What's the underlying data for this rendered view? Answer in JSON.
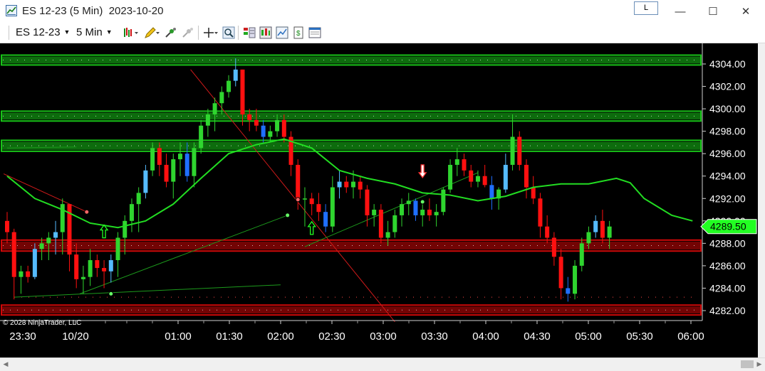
{
  "window": {
    "title": "ES 12-23 (5 Min)  2023-10-20",
    "link_button": "L",
    "minimize": "—",
    "maximize": "☐",
    "close": "✕"
  },
  "toolbar": {
    "instrument": "ES 12-23",
    "interval": "5 Min",
    "icons": [
      "bar-type-icon",
      "drawing-pencil-icon",
      "indicators-icon",
      "strategies-icon",
      "crosshair-icon",
      "zoom-icon",
      "chart-trader-icon",
      "data-box-icon",
      "properties-icon",
      "snapshot-icon",
      "share-icon"
    ]
  },
  "copyright": "© 2023 NinjaTrader, LLC",
  "colors": {
    "background": "#000000",
    "up_candle": "#2fd52f",
    "down_candle": "#ff1010",
    "tick_up": "#1f6fff",
    "tick_down": "#55bbff",
    "moving_average": "#22dd22",
    "green_zone": "#18c418",
    "red_zone": "#d10808",
    "price_marker": "#22ff22"
  },
  "chart_data": {
    "type": "candlestick",
    "instrument": "ES 12-23",
    "interval": "5 Min",
    "y_ticks": [
      4282.0,
      4284.0,
      4286.0,
      4288.0,
      4290.0,
      4292.0,
      4294.0,
      4296.0,
      4298.0,
      4300.0,
      4302.0,
      4304.0
    ],
    "ylim": [
      4280.0,
      4305.5
    ],
    "x_ticks": [
      "23:30",
      "10/20",
      "01:00",
      "01:30",
      "02:00",
      "02:30",
      "03:00",
      "03:30",
      "04:00",
      "04:30",
      "05:00",
      "05:30",
      "06:00"
    ],
    "last_price": "4289.50",
    "zones": [
      {
        "color": "green",
        "price_low": 4304.1,
        "price_high": 4304.6
      },
      {
        "color": "green",
        "price_low": 4299.1,
        "price_high": 4299.6
      },
      {
        "color": "green",
        "price_low": 4296.4,
        "price_high": 4297.0
      },
      {
        "color": "red",
        "price_low": 4287.5,
        "price_high": 4288.1
      },
      {
        "color": "red",
        "price_low": 4281.8,
        "price_high": 4282.3
      }
    ],
    "candles": [
      [
        4290,
        4290.8,
        4288,
        4289
      ],
      [
        4289,
        4289.3,
        4283,
        4285
      ],
      [
        4285,
        4286,
        4283.5,
        4285.5
      ],
      [
        4285.5,
        4286,
        4284.5,
        4285
      ],
      [
        4285,
        4288,
        4284.8,
        4287.5
      ],
      [
        4287.5,
        4288.5,
        4286.5,
        4288
      ],
      [
        4288,
        4289,
        4286.5,
        4288.5
      ],
      [
        4288.5,
        4290,
        4287,
        4289
      ],
      [
        4289,
        4292,
        4287,
        4291.5
      ],
      [
        4291.5,
        4291.5,
        4285.5,
        4287
      ],
      [
        4287,
        4288,
        4284,
        4284.8
      ],
      [
        4284.8,
        4286,
        4283.5,
        4285
      ],
      [
        4285,
        4287.5,
        4284.2,
        4286.5
      ],
      [
        4286.5,
        4287,
        4285,
        4285.8
      ],
      [
        4285.8,
        4286.5,
        4284,
        4285.5
      ],
      [
        4285.5,
        4287,
        4284.5,
        4286.5
      ],
      [
        4286.5,
        4289,
        4285,
        4288.5
      ],
      [
        4288.5,
        4290.5,
        4287,
        4290
      ],
      [
        4290,
        4292,
        4289,
        4291.5
      ],
      [
        4291.5,
        4293,
        4289,
        4292.5
      ],
      [
        4292.5,
        4295,
        4292,
        4294.5
      ],
      [
        4294.5,
        4297,
        4294,
        4296.5
      ],
      [
        4296.5,
        4297,
        4294,
        4295
      ],
      [
        4295,
        4296,
        4293,
        4293.5
      ],
      [
        4293.5,
        4296,
        4292,
        4295.5
      ],
      [
        4295.5,
        4297,
        4294,
        4296
      ],
      [
        4296,
        4297,
        4293.5,
        4294
      ],
      [
        4294,
        4297,
        4293,
        4296.5
      ],
      [
        4296.5,
        4299,
        4296,
        4298.5
      ],
      [
        4298.5,
        4300,
        4297.5,
        4299.5
      ],
      [
        4299.5,
        4301,
        4298,
        4300.5
      ],
      [
        4300.5,
        4302,
        4299.5,
        4301.5
      ],
      [
        4301.5,
        4303,
        4301,
        4302.5
      ],
      [
        4302.5,
        4304.5,
        4302,
        4303.5
      ],
      [
        4303.5,
        4303.5,
        4298.5,
        4299.5
      ],
      [
        4299.5,
        4300,
        4298,
        4299
      ],
      [
        4299,
        4300,
        4298,
        4298.5
      ],
      [
        4298.5,
        4299,
        4297,
        4297.5
      ],
      [
        4297.5,
        4298.5,
        4297,
        4298
      ],
      [
        4298,
        4299.5,
        4297.5,
        4299
      ],
      [
        4299,
        4299.5,
        4297,
        4297.5
      ],
      [
        4297.5,
        4298,
        4294,
        4295
      ],
      [
        4295,
        4295.5,
        4291,
        4292
      ],
      [
        4292,
        4293,
        4289.5,
        4292
      ],
      [
        4292,
        4292.5,
        4290.5,
        4291.5
      ],
      [
        4291.5,
        4292.5,
        4290,
        4290.8
      ],
      [
        4290.8,
        4291.5,
        4289,
        4289.5
      ],
      [
        4289.5,
        4294,
        4289,
        4293
      ],
      [
        4293,
        4294.5,
        4292,
        4293.5
      ],
      [
        4293.5,
        4294,
        4292.5,
        4293
      ],
      [
        4293,
        4294.5,
        4292,
        4293.5
      ],
      [
        4293.5,
        4294,
        4292,
        4292.8
      ],
      [
        4292.8,
        4293.2,
        4289.5,
        4290.5
      ],
      [
        4290.5,
        4291.5,
        4289.5,
        4291
      ],
      [
        4291,
        4291.5,
        4288,
        4288.5
      ],
      [
        4288.5,
        4290,
        4287.8,
        4289
      ],
      [
        4289,
        4291,
        4288.5,
        4290.5
      ],
      [
        4290.5,
        4292,
        4289.5,
        4291.5
      ],
      [
        4291.5,
        4292.5,
        4290.5,
        4291.8
      ],
      [
        4291.8,
        4292,
        4290,
        4290.5
      ],
      [
        4290.5,
        4291.5,
        4289.5,
        4291
      ],
      [
        4291,
        4292,
        4290,
        4290.5
      ],
      [
        4290.5,
        4291.5,
        4289.5,
        4290.8
      ],
      [
        4290.8,
        4293,
        4290.5,
        4292.8
      ],
      [
        4292.8,
        4295.5,
        4292.5,
        4295
      ],
      [
        4295,
        4296.5,
        4294,
        4295.5
      ],
      [
        4295.5,
        4296,
        4294,
        4294.5
      ],
      [
        4294.5,
        4295,
        4293,
        4293.5
      ],
      [
        4293.5,
        4294.5,
        4293,
        4294
      ],
      [
        4294,
        4295,
        4293,
        4293.2
      ],
      [
        4293.2,
        4294,
        4291,
        4292
      ],
      [
        4292,
        4293,
        4291,
        4292.8
      ],
      [
        4292.8,
        4296,
        4292.5,
        4295
      ],
      [
        4295,
        4299.5,
        4294.5,
        4297.5
      ],
      [
        4297.5,
        4298,
        4294.5,
        4295
      ],
      [
        4295,
        4295.5,
        4292,
        4293
      ],
      [
        4293,
        4294,
        4291.5,
        4292
      ],
      [
        4292,
        4292.5,
        4288.5,
        4289.5
      ],
      [
        4289.5,
        4290.5,
        4288,
        4288.5
      ],
      [
        4288.5,
        4289,
        4286,
        4286.8
      ],
      [
        4286.8,
        4287.5,
        4283,
        4284
      ],
      [
        4284,
        4285,
        4282.8,
        4283.5
      ],
      [
        4283.5,
        4286.5,
        4283,
        4286
      ],
      [
        4286,
        4288.5,
        4285.5,
        4288
      ],
      [
        4288,
        4289.5,
        4287.5,
        4289
      ],
      [
        4289,
        4290.5,
        4288.5,
        4290
      ],
      [
        4290,
        4291,
        4288,
        4288.5
      ],
      [
        4288.5,
        4290,
        4287.5,
        4289.5
      ]
    ],
    "moving_average": [
      [
        0,
        4294.0
      ],
      [
        4,
        4292.0
      ],
      [
        8,
        4291.0
      ],
      [
        12,
        4289.8
      ],
      [
        16,
        4289.4
      ],
      [
        20,
        4290.0
      ],
      [
        24,
        4291.5
      ],
      [
        28,
        4293.8
      ],
      [
        32,
        4296.0
      ],
      [
        36,
        4296.8
      ],
      [
        40,
        4297.3
      ],
      [
        44,
        4296.5
      ],
      [
        48,
        4294.5
      ],
      [
        52,
        4293.8
      ],
      [
        56,
        4293.3
      ],
      [
        60,
        4292.5
      ],
      [
        64,
        4292.3
      ],
      [
        68,
        4291.8
      ],
      [
        72,
        4292.2
      ],
      [
        76,
        4293.0
      ],
      [
        80,
        4293.3
      ],
      [
        84,
        4293.3
      ],
      [
        88,
        4293.8
      ],
      [
        90,
        4293.4
      ],
      [
        92,
        4292.0
      ],
      [
        96,
        4290.5
      ],
      [
        99,
        4290.0
      ]
    ],
    "trendlines": [
      {
        "color": "red",
        "from": [
          -0.5,
          4294.2
        ],
        "to": [
          11.5,
          4290.8
        ]
      },
      {
        "color": "red",
        "from": [
          26.5,
          4303.5
        ],
        "to": [
          56,
          4281.0
        ]
      },
      {
        "color": "green",
        "from": [
          1,
          4283.2
        ],
        "to": [
          39.5,
          4284.3
        ]
      },
      {
        "color": "green",
        "from": [
          10.5,
          4283.5
        ],
        "to": [
          40.5,
          4290.5
        ]
      },
      {
        "color": "green",
        "from": [
          43,
          4287.7
        ],
        "to": [
          68,
          4294.3
        ]
      },
      {
        "color": "green",
        "from": [
          0,
          4296.5
        ],
        "to": [
          10,
          4296.6
        ]
      }
    ],
    "signals": [
      {
        "type": "arrow-up",
        "color": "#22ff22",
        "index": 14,
        "price": 4289.0
      },
      {
        "type": "arrow-up",
        "color": "#22ff22",
        "index": 44,
        "price": 4289.3
      },
      {
        "type": "arrow-down",
        "color": "#ff3030",
        "index": 60,
        "price": 4294.5
      },
      {
        "type": "dot",
        "color": "#ff6666",
        "index": 11.5,
        "price": 4290.8
      },
      {
        "type": "dot",
        "color": "#66ff66",
        "index": 15,
        "price": 4283.5
      },
      {
        "type": "dot",
        "color": "#66ff66",
        "index": 40.5,
        "price": 4290.5
      },
      {
        "type": "dot",
        "color": "#ff6666",
        "index": 42,
        "price": 4291.9
      },
      {
        "type": "dot",
        "color": "#66ff66",
        "index": 60,
        "price": 4291.7
      }
    ]
  }
}
